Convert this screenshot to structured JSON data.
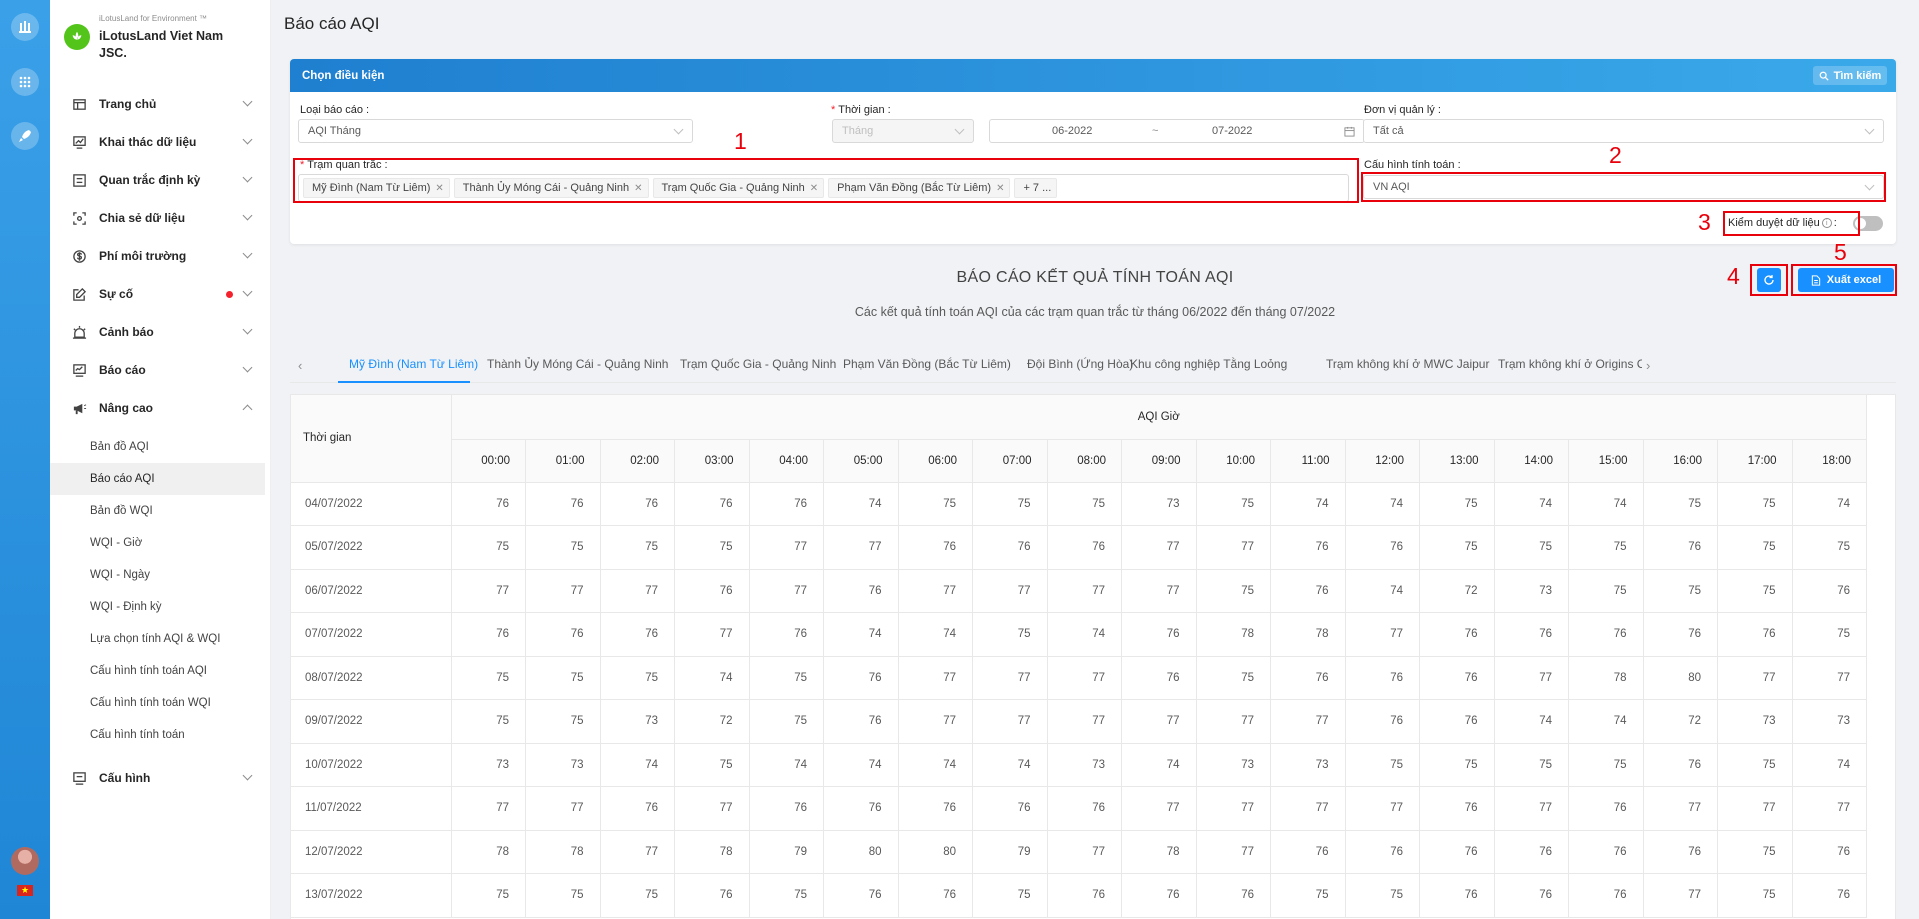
{
  "brand": {
    "tagline": "iLotusLand for Environment ™",
    "name": "iLotusLand Viet Nam JSC."
  },
  "menu": [
    {
      "label": "Trang chủ"
    },
    {
      "label": "Khai thác dữ liệu"
    },
    {
      "label": "Quan trắc định kỳ"
    },
    {
      "label": "Chia sẻ dữ liệu"
    },
    {
      "label": "Phí môi trường"
    },
    {
      "label": "Sự cố"
    },
    {
      "label": "Cảnh báo"
    },
    {
      "label": "Báo cáo"
    },
    {
      "label": "Nâng cao"
    },
    {
      "label": "Cấu hình"
    }
  ],
  "submenu": [
    "Bản đồ AQI",
    "Báo cáo AQI",
    "Bản đồ WQI",
    "WQI - Giờ",
    "WQI - Ngày",
    "WQI - Định kỳ",
    "Lựa chọn tính AQI & WQI",
    "Cấu hình tính toán AQI",
    "Cấu hình tính toán WQI",
    "Cấu hình tính toán"
  ],
  "page": {
    "title": "Báo cáo AQI"
  },
  "filters": {
    "header": "Chọn điều kiện",
    "search_label": "Tìm kiếm",
    "report_type_label": "Loại báo cáo :",
    "report_type_value": "AQI Tháng",
    "time_label": "Thời gian :",
    "time_value": "Tháng",
    "range_from": "06-2022",
    "range_sep": "~",
    "range_to": "07-2022",
    "unit_label": "Đơn vị quản lý :",
    "unit_value": "Tất cả",
    "stations_label": "Trạm quan trắc :",
    "stations": [
      "Mỹ Đình (Nam Từ Liêm)",
      "Thành Ủy Móng Cái - Quảng Ninh",
      "Trạm Quốc Gia - Quảng Ninh",
      "Phạm Văn Đồng (Bắc Từ Liêm)"
    ],
    "stations_more": "+ 7 ...",
    "config_label": "Cấu hình tính toán :",
    "config_value": "VN AQI",
    "verify_label": "Kiểm duyệt dữ liệu",
    "verify_suffix": ":",
    "verify_on": false
  },
  "annotations": [
    "1",
    "2",
    "3",
    "4",
    "5"
  ],
  "report": {
    "title": "BÁO CÁO KẾT QUẢ TÍNH TOÁN AQI",
    "subtitle": "Các kết quả tính toán AQI của các trạm quan trắc từ tháng 06/2022 đến tháng 07/2022",
    "export_label": "Xuất excel"
  },
  "tabs": [
    "Mỹ Đình (Nam Từ Liêm)",
    "Thành Ủy Móng Cái - Quảng Ninh",
    "Trạm Quốc Gia - Quảng Ninh",
    "Phạm Văn Đồng (Bắc Từ Liêm)",
    "Đội Bình (Ứng Hòa)",
    "Khu công nghiệp Tằng Loỏng",
    "Trạm không khí ở MWC Jaipur",
    "Trạm không khí ở Origins C"
  ],
  "table": {
    "time_header": "Thời gian",
    "group_header": "AQI Giờ",
    "hours": [
      "00:00",
      "01:00",
      "02:00",
      "03:00",
      "04:00",
      "05:00",
      "06:00",
      "07:00",
      "08:00",
      "09:00",
      "10:00",
      "11:00",
      "12:00",
      "13:00",
      "14:00",
      "15:00",
      "16:00",
      "17:00",
      "18:00"
    ],
    "rows": [
      {
        "date": "04/07/2022",
        "values": [
          76,
          76,
          76,
          76,
          76,
          74,
          75,
          75,
          75,
          73,
          75,
          74,
          74,
          75,
          74,
          74,
          75,
          75,
          74
        ]
      },
      {
        "date": "05/07/2022",
        "values": [
          75,
          75,
          75,
          75,
          77,
          77,
          76,
          76,
          76,
          77,
          77,
          76,
          76,
          75,
          75,
          75,
          76,
          75,
          75
        ]
      },
      {
        "date": "06/07/2022",
        "values": [
          77,
          77,
          77,
          76,
          77,
          76,
          77,
          77,
          77,
          77,
          75,
          76,
          74,
          72,
          73,
          75,
          75,
          75,
          76
        ]
      },
      {
        "date": "07/07/2022",
        "values": [
          76,
          76,
          76,
          77,
          76,
          74,
          74,
          75,
          74,
          76,
          78,
          78,
          77,
          76,
          76,
          76,
          76,
          76,
          75
        ]
      },
      {
        "date": "08/07/2022",
        "values": [
          75,
          75,
          75,
          74,
          75,
          76,
          77,
          77,
          77,
          76,
          75,
          76,
          76,
          76,
          77,
          78,
          80,
          77,
          77
        ]
      },
      {
        "date": "09/07/2022",
        "values": [
          75,
          75,
          73,
          72,
          75,
          76,
          77,
          77,
          77,
          77,
          77,
          77,
          76,
          76,
          74,
          74,
          72,
          73,
          73
        ]
      },
      {
        "date": "10/07/2022",
        "values": [
          73,
          73,
          74,
          75,
          74,
          74,
          74,
          74,
          73,
          74,
          73,
          73,
          75,
          75,
          75,
          75,
          76,
          75,
          74
        ]
      },
      {
        "date": "11/07/2022",
        "values": [
          77,
          77,
          76,
          77,
          76,
          76,
          76,
          76,
          76,
          77,
          77,
          77,
          77,
          76,
          77,
          76,
          77,
          77,
          77
        ]
      },
      {
        "date": "12/07/2022",
        "values": [
          78,
          78,
          77,
          78,
          79,
          80,
          80,
          79,
          77,
          78,
          77,
          76,
          76,
          76,
          76,
          76,
          76,
          75,
          76
        ]
      },
      {
        "date": "13/07/2022",
        "values": [
          75,
          75,
          75,
          76,
          75,
          76,
          76,
          75,
          76,
          76,
          76,
          75,
          75,
          76,
          76,
          76,
          77,
          75,
          76
        ]
      }
    ]
  }
}
